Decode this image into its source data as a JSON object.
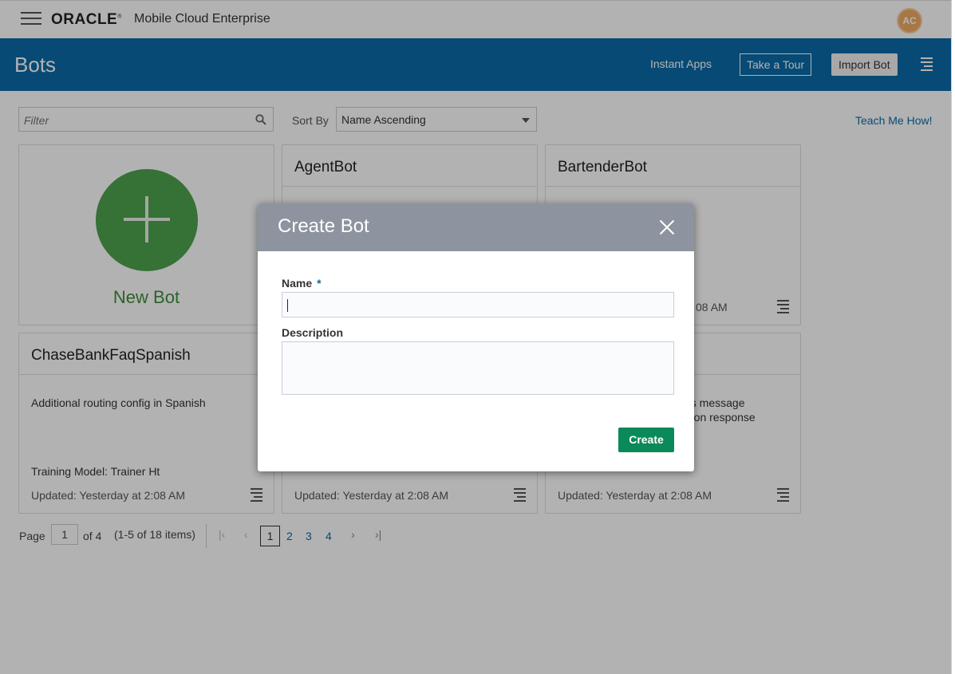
{
  "header": {
    "logo": "ORACLE",
    "logo_mark": "®",
    "product": "Mobile Cloud Enterprise",
    "avatar": "AC"
  },
  "banner": {
    "title": "Bots",
    "instant_apps": "Instant Apps",
    "take_tour": "Take a Tour",
    "import_bot": "Import Bot"
  },
  "toolbar": {
    "filter_placeholder": "Filter",
    "sort_label": "Sort By",
    "sort_value": "Name Ascending",
    "teach_me": "Teach Me How!"
  },
  "new_bot": {
    "label": "New Bot"
  },
  "cards": [
    {
      "name": "AgentBot",
      "description": "",
      "model": "",
      "updated": ""
    },
    {
      "name": "BartenderBot",
      "description": "",
      "model": "",
      "updated": "08 AM"
    },
    {
      "name": "ChaseBankFaqSpanish",
      "description": "Additional routing config in Spanish",
      "model": "Training Model: Trainer Ht",
      "updated": "Updated: Yesterday at 2:08 AM"
    },
    {
      "name": "",
      "description": "",
      "model": "",
      "updated": "Updated: Yesterday at 2:08 AM"
    },
    {
      "name": "",
      "description": "us message\nmon response",
      "model": "",
      "updated": "Updated: Yesterday at 2:08 AM"
    }
  ],
  "pager": {
    "page_label": "Page",
    "page_value": "1",
    "of_label": "of 4",
    "items_label": "(1-5 of 18 items)",
    "pages": [
      "1",
      "2",
      "3",
      "4"
    ]
  },
  "dialog": {
    "title": "Create Bot",
    "name_label": "Name",
    "required_mark": "*",
    "name_value": "",
    "description_label": "Description",
    "description_value": "",
    "create_label": "Create"
  }
}
